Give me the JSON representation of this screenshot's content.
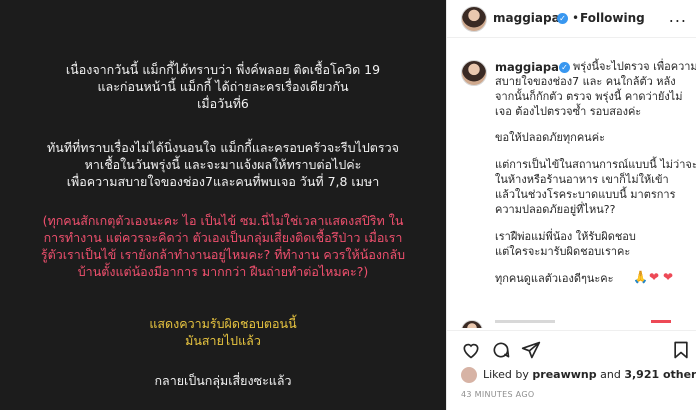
{
  "post_image": {
    "paragraph1": [
      "เนื่องจากวันนี้ แม็กกี้ได้ทราบว่า พี่งค์พลอย ติดเชื้อโควิด 19",
      "และก่อนหน้านี้ แม็กกี้ ได้ถ่ายละครเรื่องเดียวกัน",
      "เมื่อวันที่6"
    ],
    "paragraph2": [
      "ทันทีที่ทราบเรื่องไม่ได้นิ่งนอนใจ แม็กกี้และครอบครัวจะรีบไปตรวจ",
      "หาเชื้อในวันพรุ่งนี้ และจะมาแจ้งผลให้ทราบต่อไปค่ะ",
      "เพื่อความสบายใจของช่อง7และคนที่พบเจอ วันที่ 7,8 เมษา"
    ],
    "paragraph3": [
      "(ทุกคนสักเกตุตัวเองนะคะ ไอ เป็นไข้ ซม.นี่ไม่ใช่เวลาแสดงสปิริท ใน",
      "การทำงาน แต่ควรจะคิดว่า ตัวเองเป็นกลุ่มเสี่ยงติดเชื้อรึป่าว เมื่อเรา",
      "รู้ตัวเราเป็นไข้ เรายังกล้าทำงานอยู่ไหมคะ? ที่ทำงาน ควรให้น้องกลับ",
      "บ้านตั้งแต่น้องมีอาการ มากกว่า ฝืนถ่ายทำต่อไหมคะ?)"
    ],
    "paragraph4": [
      "แสดงความรับผิดชอบตอนนี้",
      "มันสายไปแล้ว"
    ],
    "paragraph5": [
      "กลายเป็นกลุ่มเสี่ยงซะแล้ว"
    ]
  },
  "header": {
    "username": "maggiapa",
    "separator": "•",
    "follow_status": "Following",
    "more": "..."
  },
  "caption": {
    "username": "maggiapa",
    "lines": [
      "พรุ่งนี้จะไปตรวจ เพื่อความ",
      "สบายใจของช่อง7 และ คนใกล้ตัว หลัง",
      "จากนั้นก็กักตัว ตรวจ พรุ่งนี้ คาดว่ายังไม่",
      "เจอ ต้องไปตรวจซ้ำ รอบสองค่ะ",
      "",
      "ขอให้ปลอดภัยทุกคนค่ะ",
      "",
      "แต่การเป็นไข้ในสถานการณ์แบบนี้ ไม่ว่าจะ",
      "ในห้างหรือร้านอาหาร เขาก็ไม่ให้เข้า",
      "แล้วในช่วงโรคระบาดแบบนี้ มาตรการ",
      "ความปลอดภัยอยู่ที่ไหน??",
      "",
      "เราฝืพ่อแม่พี่น้อง ให้รับผิดชอบ",
      "แต่ใครจะมารับผิดชอบเราคะ",
      "",
      "ทุกคนดูแลตัวเองดีๆนะคะ"
    ],
    "emojis": [
      "🙏",
      "❤",
      "❤"
    ]
  },
  "actions": {
    "like_icon": "heart-icon",
    "comment_icon": "comment-icon",
    "share_icon": "share-icon",
    "save_icon": "bookmark-icon"
  },
  "likes": {
    "prefix": "Liked by",
    "user": "preawwnp",
    "conj": "and",
    "count": "3,921 others"
  },
  "timestamp": "43 MINUTES AGO",
  "colors": {
    "post_bg": "#1c1c1c",
    "text_white": "#f2f2f2",
    "text_pink": "#f0506e",
    "text_yellow": "#e8c540",
    "verified": "#3897f0",
    "heart": "#ed4956"
  }
}
